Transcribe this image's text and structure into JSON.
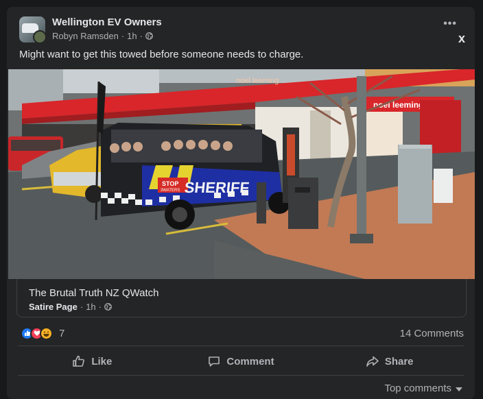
{
  "post": {
    "group_name": "Wellington EV Owners",
    "author": "Robyn Ramsden",
    "time": "1h",
    "text": "Might want to get this towed before someone needs to charge."
  },
  "photo": {
    "shop_sign": "noel leeming",
    "awning_sign": "noel leeming",
    "van_text": "SHERIFF",
    "stop_sign": "STOP",
    "stop_sub": "3WATERS"
  },
  "shared": {
    "title": "The Brutal Truth NZ QWatch",
    "page_type": "Satire Page",
    "time": "1h"
  },
  "engagement": {
    "reaction_count": "7",
    "comments": "14 Comments"
  },
  "actions": {
    "like": "Like",
    "comment": "Comment",
    "share": "Share"
  },
  "sort": {
    "label": "Top comments"
  },
  "icons": {
    "more": "•••",
    "close": "x"
  },
  "colors": {
    "background": "#18191a",
    "card": "#242526",
    "text": "#e4e6eb",
    "secondary_text": "#b0b3b8",
    "like_blue": "#2078f4",
    "love_red": "#f33e58",
    "haha_yellow": "#f7b125"
  }
}
